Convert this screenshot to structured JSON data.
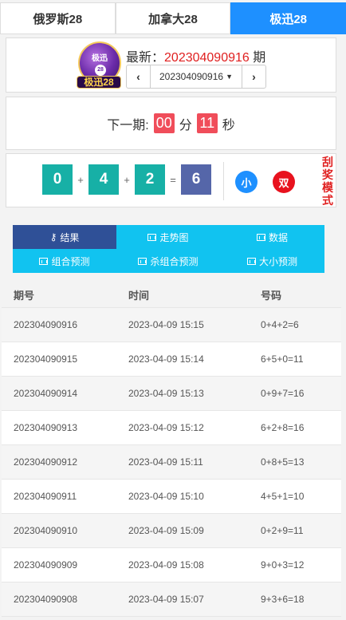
{
  "tabs": [
    {
      "label": "俄罗斯28",
      "active": false
    },
    {
      "label": "加拿大28",
      "active": false
    },
    {
      "label": "极迅28",
      "active": true
    }
  ],
  "logo": {
    "top_text": "极迅",
    "ball_number": "28",
    "ribbon_text": "极迅28"
  },
  "latest": {
    "prefix": "最新：",
    "issue": "202304090916",
    "suffix": " 期"
  },
  "selector": {
    "prev_icon": "chevron-left-icon",
    "value": "202304090916",
    "next_icon": "chevron-right-icon"
  },
  "countdown": {
    "label": "下一期:",
    "minutes": "00",
    "minutes_unit": "分",
    "seconds": "11",
    "seconds_unit": "秒"
  },
  "result": {
    "d1": "0",
    "plus1": "+",
    "d2": "4",
    "plus2": "+",
    "d3": "2",
    "eq": "=",
    "sum": "6",
    "size": "小",
    "parity": "双",
    "mode": [
      "刮",
      "奖",
      "模",
      "式"
    ]
  },
  "nav": [
    {
      "label": "结果",
      "icon": "key-icon",
      "active": true
    },
    {
      "label": "走势图",
      "icon": "chart-icon",
      "active": false
    },
    {
      "label": "数据",
      "icon": "chart-icon",
      "active": false
    },
    {
      "label": "组合预测",
      "icon": "chart-icon",
      "active": false
    },
    {
      "label": "杀组合预测",
      "icon": "chart-icon",
      "active": false
    },
    {
      "label": "大小预测",
      "icon": "chart-icon",
      "active": false
    }
  ],
  "table": {
    "headers": [
      "期号",
      "时间",
      "号码"
    ],
    "rows": [
      [
        "202304090916",
        "2023-04-09 15:15",
        "0+4+2=6"
      ],
      [
        "202304090915",
        "2023-04-09 15:14",
        "6+5+0=11"
      ],
      [
        "202304090914",
        "2023-04-09 15:13",
        "0+9+7=16"
      ],
      [
        "202304090913",
        "2023-04-09 15:12",
        "6+2+8=16"
      ],
      [
        "202304090912",
        "2023-04-09 15:11",
        "0+8+5=13"
      ],
      [
        "202304090911",
        "2023-04-09 15:10",
        "4+5+1=10"
      ],
      [
        "202304090910",
        "2023-04-09 15:09",
        "0+2+9=11"
      ],
      [
        "202304090909",
        "2023-04-09 15:08",
        "9+0+3=12"
      ],
      [
        "202304090908",
        "2023-04-09 15:07",
        "9+3+6=18"
      ]
    ]
  }
}
